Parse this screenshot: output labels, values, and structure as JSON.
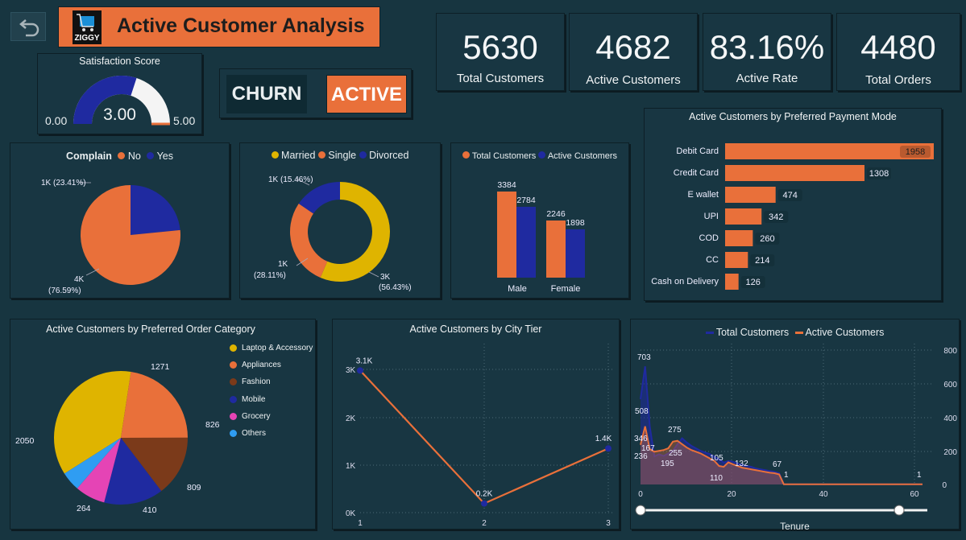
{
  "header": {
    "title": "Active Customer Analysis",
    "logo_text": "ZIGGY"
  },
  "colors": {
    "orange": "#e9703a",
    "navy": "#1f2aa0",
    "yellow": "#dfb400",
    "bg": "#173540",
    "brown": "#7b3a1a",
    "pink": "#e544b5",
    "lightblue": "#2f9df2"
  },
  "kpis": [
    {
      "value": "5630",
      "label": "Total Customers"
    },
    {
      "value": "4682",
      "label": "Active Customers"
    },
    {
      "value": "83.16%",
      "label": "Active Rate"
    },
    {
      "value": "4480",
      "label": "Total Orders"
    }
  ],
  "gauge": {
    "title": "Satisfaction Score",
    "value_text": "3.00",
    "min_text": "0.00",
    "max_text": "5.00",
    "value": 3,
    "min": 0,
    "max": 5
  },
  "toggle": {
    "churn": "CHURN",
    "active": "ACTIVE"
  },
  "complain": {
    "legend_title": "Complain",
    "legend": [
      "No",
      "Yes"
    ],
    "labels": [
      "1K (23.41%)",
      "4K",
      "(76.59%)"
    ]
  },
  "marital": {
    "legend": [
      "Married",
      "Single",
      "Divorced"
    ],
    "labels": [
      "1K (15.46%)",
      "1K",
      "(28.11%)",
      "3K",
      "(56.43%)"
    ]
  },
  "gender": {
    "legend": [
      "Total Customers",
      "Active Customers"
    ],
    "values_text": [
      "3384",
      "2784",
      "2246",
      "1898"
    ],
    "categories": [
      "Male",
      "Female"
    ]
  },
  "payment": {
    "title": "Active Customers by Preferred Payment Mode",
    "labels": [
      "Debit Card",
      "Credit Card",
      "E wallet",
      "UPI",
      "COD",
      "CC",
      "Cash on Delivery"
    ],
    "values_text": [
      "1958",
      "1308",
      "474",
      "342",
      "260",
      "214",
      "126"
    ]
  },
  "category": {
    "title": "Active Customers by Preferred Order Category",
    "legend": [
      "Laptop & Accessory",
      "Appliances",
      "Fashion",
      "Mobile",
      "Grocery",
      "Others"
    ],
    "values_text": [
      "2050",
      "1271",
      "826",
      "809",
      "410",
      "264"
    ]
  },
  "city": {
    "title": "Active Customers by City Tier",
    "yticks": [
      "3K",
      "2K",
      "1K",
      "0K"
    ],
    "xticks": [
      "1",
      "2",
      "3"
    ],
    "point_labels": [
      "3.1K",
      "0.2K",
      "1.4K"
    ]
  },
  "tenure": {
    "legend": [
      "Total Customers",
      "Active Customers"
    ],
    "yticks": [
      "800",
      "600",
      "400",
      "200",
      "0"
    ],
    "xticks": [
      "0",
      "20",
      "40",
      "60"
    ],
    "xlabel": "Tenure",
    "annotations": [
      "703",
      "508",
      "346",
      "167",
      "236",
      "195",
      "255",
      "275",
      "105",
      "110",
      "132",
      "67",
      "1",
      "1"
    ]
  },
  "chart_data": [
    {
      "type": "pie",
      "title": "Complain",
      "categories": [
        "No",
        "Yes"
      ],
      "values": [
        76.59,
        23.41
      ]
    },
    {
      "type": "pie",
      "categories": [
        "Married",
        "Single",
        "Divorced"
      ],
      "values": [
        56.43,
        28.11,
        15.46
      ]
    },
    {
      "type": "bar",
      "categories": [
        "Male",
        "Female"
      ],
      "series": [
        {
          "name": "Total Customers",
          "values": [
            3384,
            2246
          ]
        },
        {
          "name": "Active Customers",
          "values": [
            2784,
            1898
          ]
        }
      ]
    },
    {
      "type": "bar",
      "title": "Active Customers by Preferred Payment Mode",
      "categories": [
        "Debit Card",
        "Credit Card",
        "E wallet",
        "UPI",
        "COD",
        "CC",
        "Cash on Delivery"
      ],
      "values": [
        1958,
        1308,
        474,
        342,
        260,
        214,
        126
      ]
    },
    {
      "type": "pie",
      "title": "Active Customers by Preferred Order Category",
      "categories": [
        "Laptop & Accessory",
        "Appliances",
        "Fashion",
        "Mobile",
        "Grocery",
        "Others"
      ],
      "values": [
        2050,
        1271,
        826,
        809,
        410,
        264
      ]
    },
    {
      "type": "line",
      "title": "Active Customers by City Tier",
      "x": [
        1,
        2,
        3
      ],
      "values": [
        3100,
        200,
        1400
      ],
      "ylim": [
        0,
        3300
      ]
    },
    {
      "type": "area",
      "xlabel": "Tenure",
      "ylim": [
        0,
        800
      ],
      "xlim": [
        0,
        61
      ],
      "series": [
        {
          "name": "Total Customers",
          "x": [
            0,
            1,
            2,
            3,
            4,
            5,
            6,
            7,
            8,
            9,
            10,
            11,
            12,
            13,
            14,
            15,
            16,
            17,
            18,
            19,
            20,
            21,
            22,
            23,
            24,
            25,
            26,
            27,
            28,
            29,
            30,
            31,
            61
          ],
          "values": [
            508,
            703,
            346,
            167,
            180,
            170,
            185,
            200,
            240,
            275,
            250,
            230,
            215,
            200,
            190,
            180,
            165,
            150,
            130,
            140,
            135,
            125,
            115,
            110,
            105,
            95,
            90,
            85,
            80,
            75,
            67,
            1,
            1
          ]
        },
        {
          "name": "Active Customers",
          "x": [
            0,
            1,
            2,
            3,
            4,
            5,
            6,
            7,
            8,
            9,
            10,
            11,
            12,
            13,
            14,
            15,
            16,
            17,
            18,
            19,
            20,
            21,
            22,
            23,
            24,
            25,
            26,
            27,
            28,
            29,
            30,
            31,
            61
          ],
          "values": [
            236,
            346,
            210,
            195,
            200,
            205,
            215,
            255,
            260,
            240,
            220,
            205,
            195,
            185,
            170,
            155,
            140,
            110,
            105,
            132,
            120,
            110,
            100,
            95,
            90,
            85,
            80,
            75,
            70,
            67,
            60,
            1,
            1
          ]
        }
      ]
    }
  ]
}
